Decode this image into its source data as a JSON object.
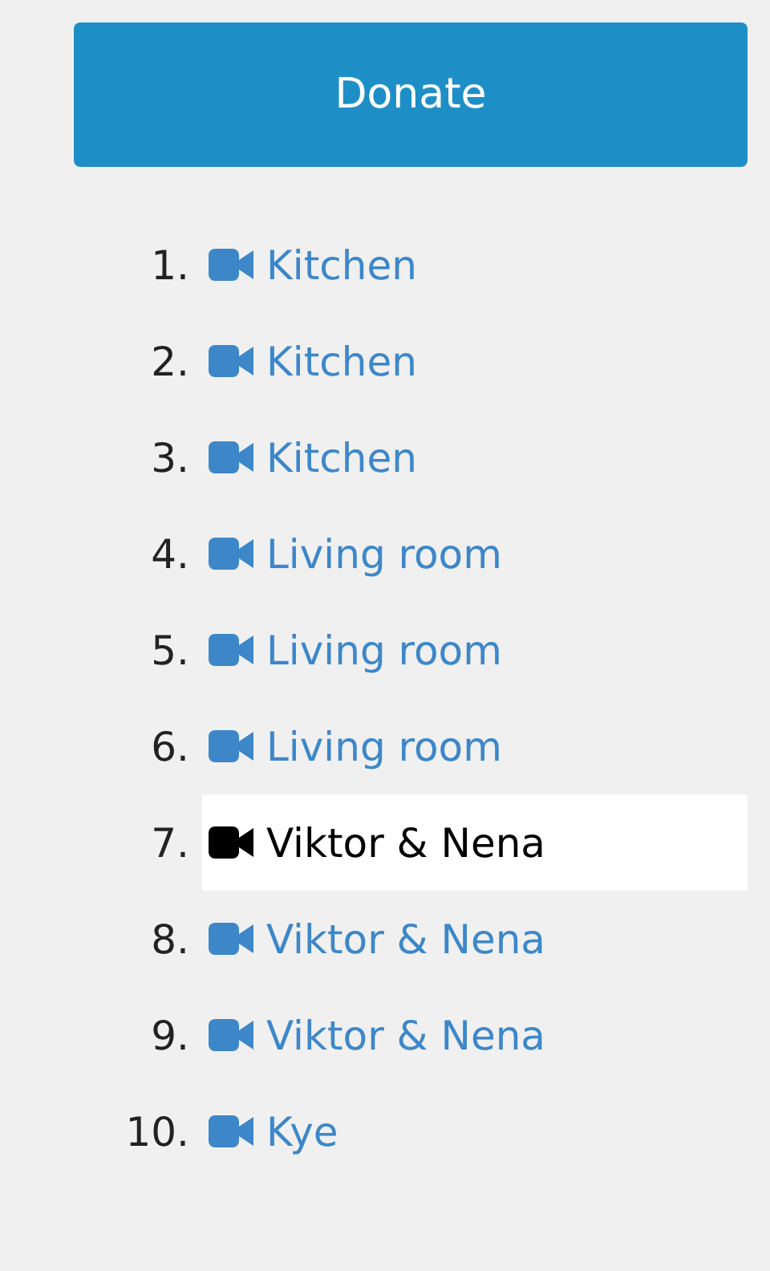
{
  "donate_button": {
    "label": "Donate"
  },
  "videos": [
    {
      "number": "1.",
      "label": "Kitchen",
      "selected": false
    },
    {
      "number": "2.",
      "label": "Kitchen",
      "selected": false
    },
    {
      "number": "3.",
      "label": "Kitchen",
      "selected": false
    },
    {
      "number": "4.",
      "label": "Living room",
      "selected": false
    },
    {
      "number": "5.",
      "label": "Living room",
      "selected": false
    },
    {
      "number": "6.",
      "label": "Living room",
      "selected": false
    },
    {
      "number": "7.",
      "label": "Viktor & Nena",
      "selected": true
    },
    {
      "number": "8.",
      "label": "Viktor & Nena",
      "selected": false
    },
    {
      "number": "9.",
      "label": "Viktor & Nena",
      "selected": false
    },
    {
      "number": "10.",
      "label": "Kye",
      "selected": false
    }
  ]
}
